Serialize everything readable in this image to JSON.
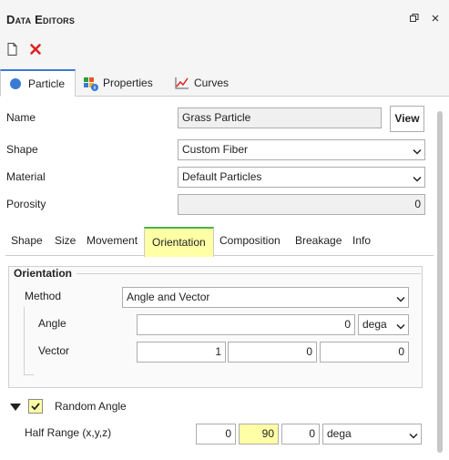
{
  "window": {
    "title": "Data Editors",
    "restore_icon": "restore-window-icon",
    "close_icon": "close-icon"
  },
  "toolbar": {
    "new_icon": "new-document-icon",
    "delete_icon": "delete-icon"
  },
  "main_tabs": [
    {
      "label": "Particle",
      "icon": "particle-icon",
      "active": true
    },
    {
      "label": "Properties",
      "icon": "properties-icon",
      "active": false
    },
    {
      "label": "Curves",
      "icon": "curves-icon",
      "active": false
    }
  ],
  "form": {
    "name_label": "Name",
    "name_value": "Grass Particle",
    "view_button": "View",
    "shape_label": "Shape",
    "shape_value": "Custom Fiber",
    "material_label": "Material",
    "material_value": "Default Particles",
    "porosity_label": "Porosity",
    "porosity_value": "0"
  },
  "sub_tabs": [
    {
      "label": "Shape"
    },
    {
      "label": "Size"
    },
    {
      "label": "Movement"
    },
    {
      "label": "Orientation",
      "active": true
    },
    {
      "label": "Composition"
    },
    {
      "label": "Breakage"
    },
    {
      "label": "Info"
    }
  ],
  "orientation": {
    "group_title": "Orientation",
    "method_label": "Method",
    "method_value": "Angle and Vector",
    "angle_label": "Angle",
    "angle_value": "0",
    "angle_unit": "dega",
    "vector_label": "Vector",
    "vector_x": "1",
    "vector_y": "0",
    "vector_z": "0"
  },
  "random_angle": {
    "label": "Random Angle",
    "checked": true,
    "half_range_label": "Half Range (x,y,z)",
    "x": "0",
    "y": "90",
    "z": "0",
    "unit": "dega"
  },
  "colors": {
    "highlight": "#ffffa6",
    "active_tab_border": "#4caf50",
    "main_tab_accent": "#3a7bd5",
    "delete_red": "#e02020"
  }
}
